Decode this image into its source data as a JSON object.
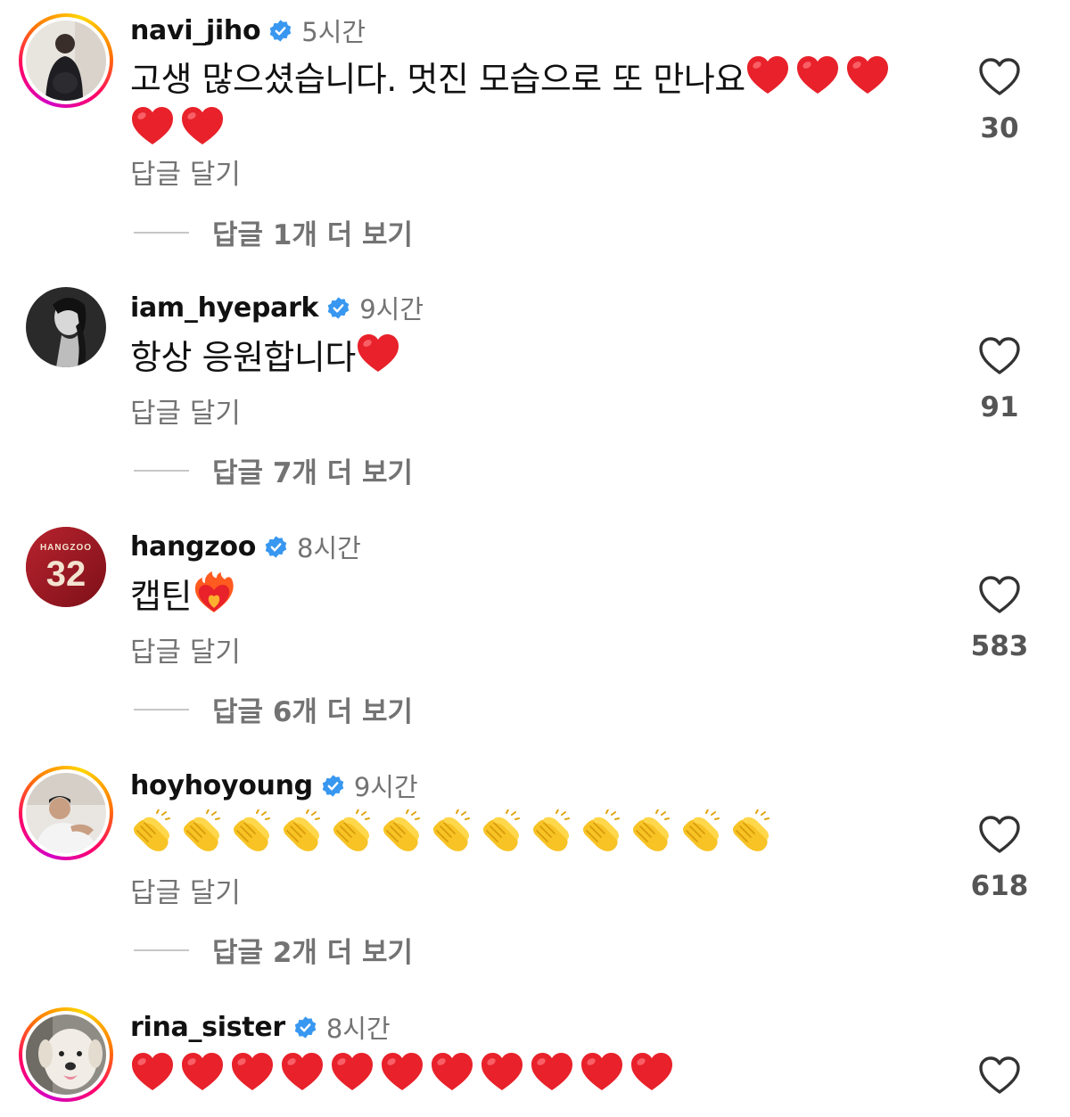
{
  "colors": {
    "verified": "#3897f0",
    "secondary_text": "#737373",
    "heart_red": "#e8212a"
  },
  "comments": [
    {
      "username": "navi_jiho",
      "time": "5시간",
      "text": "고생 많으셨습니다. 멋진 모습으로 또 만나요",
      "emoji": "red-heart",
      "emoji_count": 5,
      "reply": "답글 달기",
      "view_replies": "답글 1개 더 보기",
      "likes": "30",
      "story_ring": true
    },
    {
      "username": "iam_hyepark",
      "time": "9시간",
      "text": "항상 응원합니다",
      "emoji": "red-heart",
      "emoji_count": 1,
      "reply": "답글 달기",
      "view_replies": "답글 7개 더 보기",
      "likes": "91",
      "story_ring": false
    },
    {
      "username": "hangzoo",
      "time": "8시간",
      "text": "캡틴",
      "emoji": "heart-on-fire",
      "emoji_count": 1,
      "reply": "답글 달기",
      "view_replies": "답글 6개 더 보기",
      "likes": "583",
      "story_ring": false,
      "avatar_text": "HANGZOO",
      "avatar_number": "32"
    },
    {
      "username": "hoyhoyoung",
      "time": "9시간",
      "text": "",
      "emoji": "clapping-hands",
      "emoji_count": 13,
      "reply": "답글 달기",
      "view_replies": "답글 2개 더 보기",
      "likes": "618",
      "story_ring": true
    },
    {
      "username": "rina_sister",
      "time": "8시간",
      "text": "",
      "emoji": "red-heart",
      "emoji_count": 11,
      "reply": "",
      "view_replies": "",
      "likes": "",
      "story_ring": true
    }
  ]
}
